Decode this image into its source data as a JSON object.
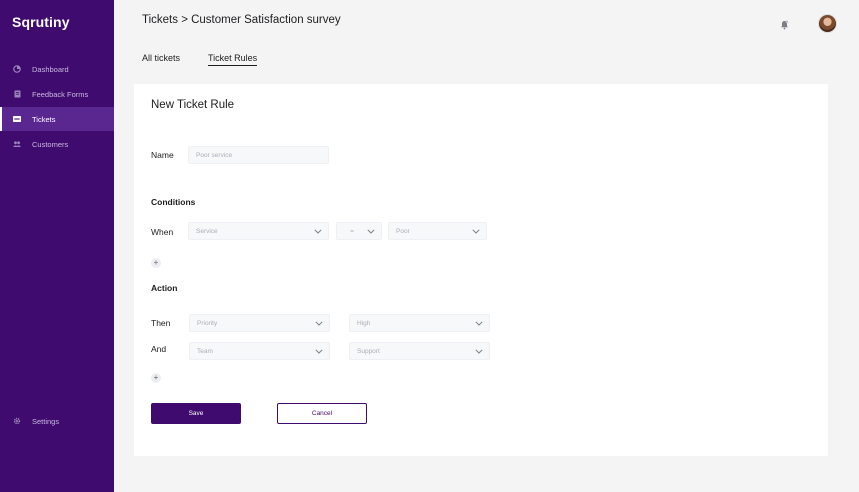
{
  "app": {
    "logo": "Sqrutiny"
  },
  "sidebar": {
    "items": [
      {
        "label": "Dashboard",
        "icon": "chart-icon"
      },
      {
        "label": "Feedback Forms",
        "icon": "form-icon"
      },
      {
        "label": "Tickets",
        "icon": "ticket-icon",
        "active": true
      },
      {
        "label": "Customers",
        "icon": "users-icon"
      }
    ],
    "settings": {
      "label": "Settings",
      "icon": "gear-icon"
    }
  },
  "header": {
    "breadcrumb": "Tickets > Customer Satisfaction survey"
  },
  "tabs": [
    {
      "label": "All tickets",
      "active": false
    },
    {
      "label": "Ticket Rules",
      "active": true
    }
  ],
  "form": {
    "title": "New Ticket Rule",
    "name": {
      "label": "Name",
      "placeholder": "Poor service"
    },
    "conditions": {
      "heading": "Conditions",
      "when_label": "When",
      "field": "Service",
      "operator": "=",
      "value": "Poor"
    },
    "action": {
      "heading": "Action",
      "then_label": "Then",
      "then_field": "Priority",
      "then_value": "High",
      "and_label": "And",
      "and_field": "Team",
      "and_value": "Support"
    },
    "add_symbol": "+",
    "save_label": "Save",
    "cancel_label": "Cancel"
  },
  "colors": {
    "brand": "#3f0b6e",
    "sidebar_active": "#5a2690"
  }
}
